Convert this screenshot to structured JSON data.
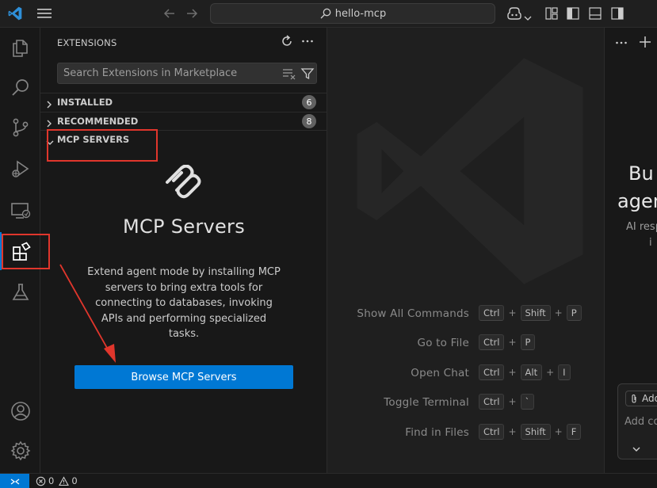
{
  "titlebar": {
    "search_text": "hello-mcp"
  },
  "sidebar": {
    "title": "EXTENSIONS",
    "search_placeholder": "Search Extensions in Marketplace",
    "sections": [
      {
        "label": "INSTALLED",
        "count": "6",
        "expanded": false
      },
      {
        "label": "RECOMMENDED",
        "count": "8",
        "expanded": false
      },
      {
        "label": "MCP SERVERS",
        "expanded": true
      }
    ],
    "mcp": {
      "heading": "MCP Servers",
      "description": "Extend agent mode by installing MCP servers to bring extra tools for connecting to databases, invoking APIs and performing specialized tasks.",
      "button_label": "Browse MCP Servers"
    }
  },
  "editor": {
    "shortcuts": [
      {
        "label": "Show All Commands",
        "keys": [
          "Ctrl",
          "Shift",
          "P"
        ]
      },
      {
        "label": "Go to File",
        "keys": [
          "Ctrl",
          "P"
        ]
      },
      {
        "label": "Open Chat",
        "keys": [
          "Ctrl",
          "Alt",
          "I"
        ]
      },
      {
        "label": "Toggle Terminal",
        "keys": [
          "Ctrl",
          "`"
        ]
      },
      {
        "label": "Find in Files",
        "keys": [
          "Ctrl",
          "Shift",
          "F"
        ]
      }
    ]
  },
  "chat": {
    "title_line1": "Bu",
    "title_line2": "agen",
    "subtitle_line1": "AI resp",
    "subtitle_line2": "i",
    "add_context": "Add",
    "input_placeholder": "Add co"
  },
  "statusbar": {
    "errors": "0",
    "warnings": "0"
  },
  "colors": {
    "accent": "#0078d4",
    "annotation": "#e0362c",
    "badge": "#616161"
  }
}
